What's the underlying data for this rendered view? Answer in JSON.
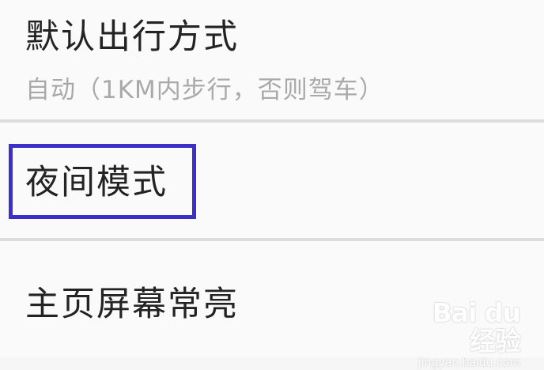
{
  "settings": {
    "items": [
      {
        "title": "默认出行方式",
        "subtitle": "自动（1KM内步行，否则驾车）"
      },
      {
        "title": "夜间模式"
      },
      {
        "title": "主页屏幕常亮"
      }
    ],
    "highlight_color": "#3a2fc8"
  },
  "watermark": {
    "logo": "Bai du 经验",
    "url": "jingyan.baidu.com"
  }
}
